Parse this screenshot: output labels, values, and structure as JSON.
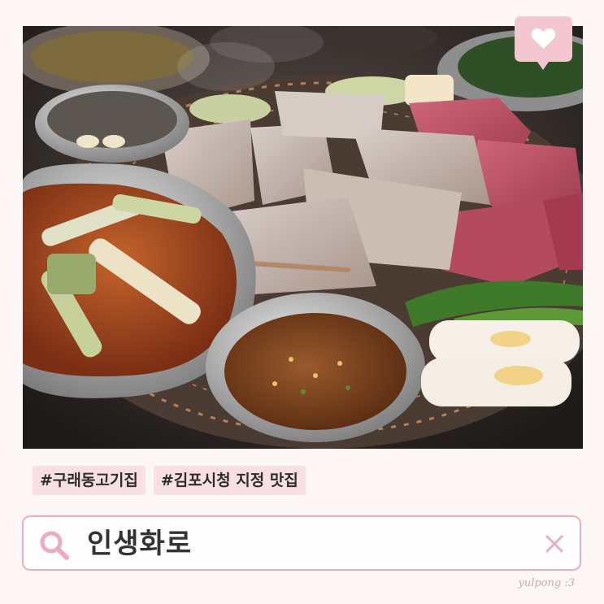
{
  "photo": {
    "subject": "korean-bbq-grill-photo"
  },
  "badge": {
    "icon": "heart-icon",
    "color": "#f2c7d0"
  },
  "tags": [
    {
      "label": "#구래동고기집"
    },
    {
      "label": "#김포시청 지정 맛집"
    }
  ],
  "search": {
    "query": "인생화로",
    "search_icon": "search-icon",
    "clear_icon": "close-icon",
    "accent": "#e9aebd"
  },
  "watermark": {
    "text": "yulpong :3"
  }
}
